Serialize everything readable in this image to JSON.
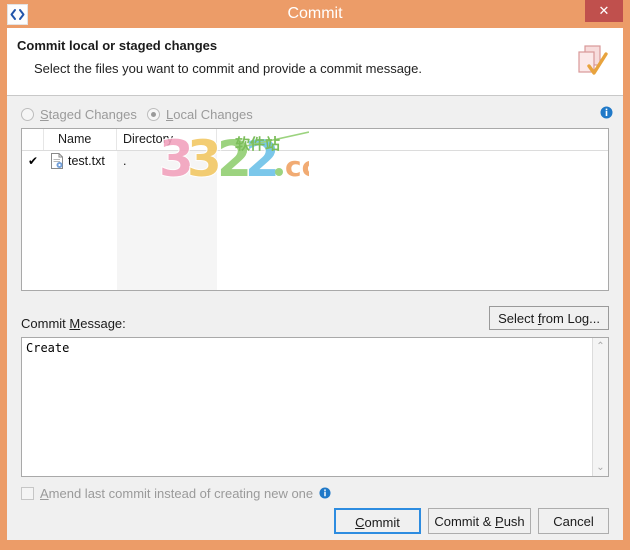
{
  "window": {
    "title": "Commit",
    "app_icon": "code-brackets-icon",
    "close_label": "✕",
    "titlebar_color": "#ec9c68",
    "close_button_color": "#c0504d"
  },
  "header": {
    "title": "Commit local or staged changes",
    "subtitle": "Select the files you want to commit and provide a commit message.",
    "icon": "commit-document-check-icon"
  },
  "source_selector": {
    "options": [
      {
        "label_before": "S",
        "label_mnemonic": "S",
        "label": "Staged Changes",
        "selected": false
      },
      {
        "label_before": "L",
        "label_mnemonic": "L",
        "label": "Local Changes",
        "selected": true
      }
    ],
    "staged_label_pre": "",
    "staged_mnemonic": "S",
    "staged_label_post": "taged Changes",
    "local_label_pre": "",
    "local_mnemonic": "L",
    "local_label_post": "ocal Changes",
    "info_icon": "info-icon"
  },
  "file_table": {
    "columns": [
      "",
      "Name",
      "Directory",
      ""
    ],
    "col_check": "",
    "col_name": "Name",
    "col_directory": "Directory",
    "col_rest": "",
    "rows": [
      {
        "checked": true,
        "check_glyph": "✔",
        "icon": "text-file-icon",
        "name": "test.txt",
        "directory": "."
      }
    ]
  },
  "commit_message": {
    "label_pre": "Commit ",
    "label_mnemonic": "M",
    "label_post": "essage:",
    "value": "Create",
    "select_from_log_pre": "Select ",
    "select_from_log_mnemonic": "f",
    "select_from_log_post": "rom Log...",
    "scrollbar_up": "⌃",
    "scrollbar_down": "⌄"
  },
  "amend": {
    "label_pre": "",
    "label_mnemonic": "A",
    "label_post": "mend last commit instead of creating new one",
    "checked": false,
    "info_icon": "info-icon"
  },
  "footer": {
    "commit_pre": "",
    "commit_mnemonic": "C",
    "commit_post": "ommit",
    "commit_push_pre": "Commit & ",
    "commit_push_mnemonic": "P",
    "commit_push_post": "ush",
    "cancel_label": "Cancel",
    "default_button_outline": "#2d8ce0"
  },
  "watermark": {
    "text": "3322",
    "suffix": ".cc",
    "cn_text": "软件站"
  }
}
